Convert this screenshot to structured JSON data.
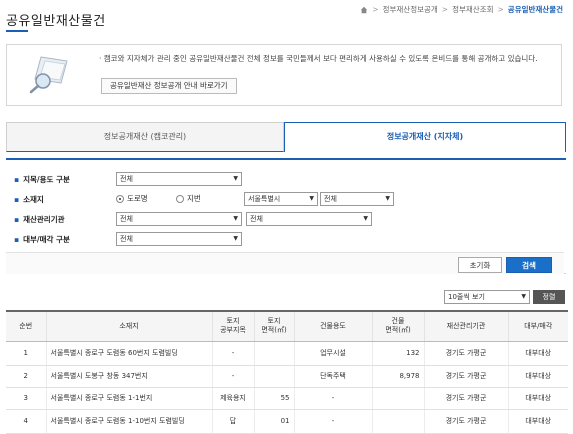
{
  "page": {
    "title": "공유일반재산물건"
  },
  "breadcrumb": {
    "items": [
      "정부재산정보공개",
      "정부재산조회",
      "공유일반재산물건"
    ],
    "separator": ">"
  },
  "notice": {
    "text": "· 캠코와 지자체가 관리 중인 공유일반재산물건 전체 정보를 국민들께서 보다 편리하게 사용하실 수 있도록 온비드를 통해 공개하고 있습니다.",
    "button_label": "공유일반재산 정보공개 안내 바로가기"
  },
  "tabs": [
    {
      "label": "정보공개재산 (캠코관리)",
      "active": false
    },
    {
      "label": "정보공개재산 (지자체)",
      "active": true
    }
  ],
  "filters": {
    "category": {
      "label": "지목/용도 구분",
      "value": "전체"
    },
    "location": {
      "label": "소재지",
      "radio_road": "도로명",
      "radio_lot": "지번",
      "selected": "도로명",
      "city": "서울특별시",
      "district": "전체"
    },
    "agency": {
      "label": "재산관리기관",
      "value1": "전체",
      "value2": "전체"
    },
    "lease": {
      "label": "대부/매각 구분",
      "value": "전체"
    },
    "reset_label": "초기화",
    "search_label": "검색"
  },
  "list_controls": {
    "page_size": "10줄씩 보기",
    "sort_label": "정렬"
  },
  "table": {
    "headers": [
      "순번",
      "소재지",
      "토지\n공부지목",
      "토지\n면적(㎡)",
      "건물용도",
      "건물\n면적(㎡)",
      "재산관리기관",
      "대부/매각"
    ],
    "rows": [
      [
        "1",
        "서울특별시 종로구 도렴동 60번지 도렴빌딩",
        "-",
        "",
        "업무시설",
        "132",
        "경기도 가평군",
        "대부대상"
      ],
      [
        "2",
        "서울특별시 도봉구 창동 347번지",
        "-",
        "",
        "단독주택",
        "8,978",
        "경기도 가평군",
        "대부대상"
      ],
      [
        "3",
        "서울특별시 종로구 도렴동 1-1번지",
        "제육용지",
        "55",
        "-",
        "",
        "경기도 가평군",
        "대부대상"
      ],
      [
        "4",
        "서울특별시 종로구 도렴동 1-10번지 도렴빌딩",
        "답",
        "01",
        "-",
        "",
        "경기도 가평군",
        "대부대상"
      ]
    ]
  },
  "colors": {
    "accent": "#1a5fb4",
    "button": "#1a6fc8"
  }
}
